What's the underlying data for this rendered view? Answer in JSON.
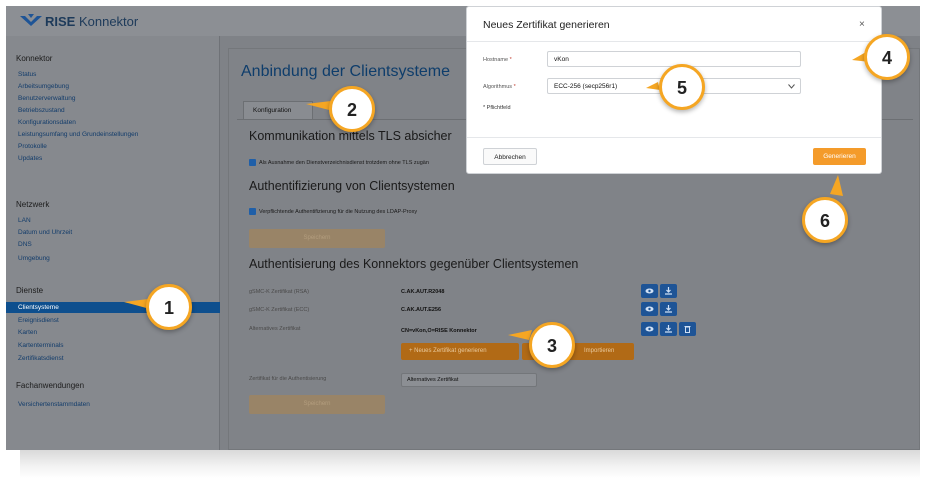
{
  "app": {
    "brand_bold": "RISE",
    "brand_light": "Konnektor"
  },
  "sidebar": {
    "sections": [
      {
        "heading": "Konnektor",
        "items": [
          "Status",
          "Arbeitsumgebung",
          "Benutzerverwaltung",
          "Betriebszustand",
          "Konfigurationsdaten",
          "Leistungsumfang und Grundeinstellungen",
          "Protokolle",
          "Updates"
        ]
      },
      {
        "heading": "Netzwerk",
        "items": [
          "LAN",
          "Datum und Uhrzeit",
          "DNS",
          "Umgebung"
        ]
      },
      {
        "heading": "Dienste",
        "items": [
          "Clientsysteme",
          "Ereignisdienst",
          "Karten",
          "Kartenterminals",
          "Zertifikatsdienst"
        ]
      },
      {
        "heading": "Fachanwendungen",
        "items": [
          "Versichertenstammdaten"
        ]
      }
    ],
    "active_item": "Clientsysteme"
  },
  "main": {
    "page_title": "Anbindung der Clientsysteme",
    "tab_label": "Konfiguration",
    "section_tls": "Kommunikation mittels TLS absicher",
    "tls_checkbox_label": "Als Ausnahme den Dienstverzeichnisdienst trotzdem ohne TLS zugän",
    "section_auth": "Authentifizierung von Clientsystemen",
    "auth_checkbox_label": "Verpflichtende Authentifizierung für die Nutzung des LDAP-Proxy",
    "save_label": "Speichern",
    "section_konn_auth": "Authentisierung des Konnektors gegenüber Clientsystemen",
    "cert_rows": [
      {
        "label": "gSMC-K Zertifikat (RSA)",
        "value": "C.AK.AUT.R2048"
      },
      {
        "label": "gSMC-K Zertifikat (ECC)",
        "value": "C.AK.AUT.E256"
      },
      {
        "label": "Alternatives Zertifikat",
        "value": "CN=vKon,O=RISE Konnektor"
      }
    ],
    "new_cert_button": "+ Neues Zertifikat generieren",
    "import_button": "Importieren",
    "auth_cert_label": "Zertifikat für die Authentisierung",
    "auth_cert_value": "Alternatives Zertifikat",
    "save_label_2": "Speichern"
  },
  "modal": {
    "title": "Neues Zertifikat generieren",
    "close": "×",
    "hostname_label": "Hostname",
    "hostname_value": "vKon",
    "algorithm_label": "Algorithmus",
    "algorithm_value": "ECC-256 (secp256r1)",
    "required_mark": "*",
    "required_note": "* Pflichtfeld",
    "cancel_label": "Abbrechen",
    "generate_label": "Generieren"
  },
  "callouts": [
    "1",
    "2",
    "3",
    "4",
    "5",
    "6"
  ],
  "colors": {
    "accent": "#f5a623",
    "primary": "#0e4f8e",
    "generate": "#f49b2a"
  },
  "icons": [
    "rise-logo-icon",
    "eye-icon",
    "download-icon",
    "trash-icon",
    "chevron-down-icon",
    "close-icon"
  ]
}
